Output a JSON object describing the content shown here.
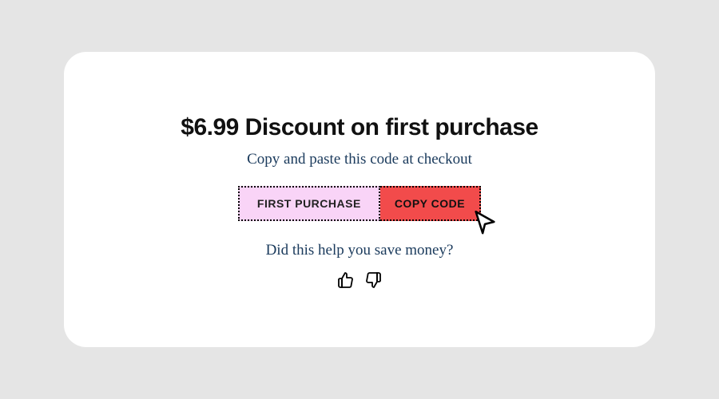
{
  "card": {
    "title": "$6.99 Discount on first purchase",
    "subtitle": "Copy and paste this code at checkout",
    "code": "FIRST PURCHASE",
    "copy_label": "COPY CODE",
    "question": "Did this help you save money?"
  }
}
